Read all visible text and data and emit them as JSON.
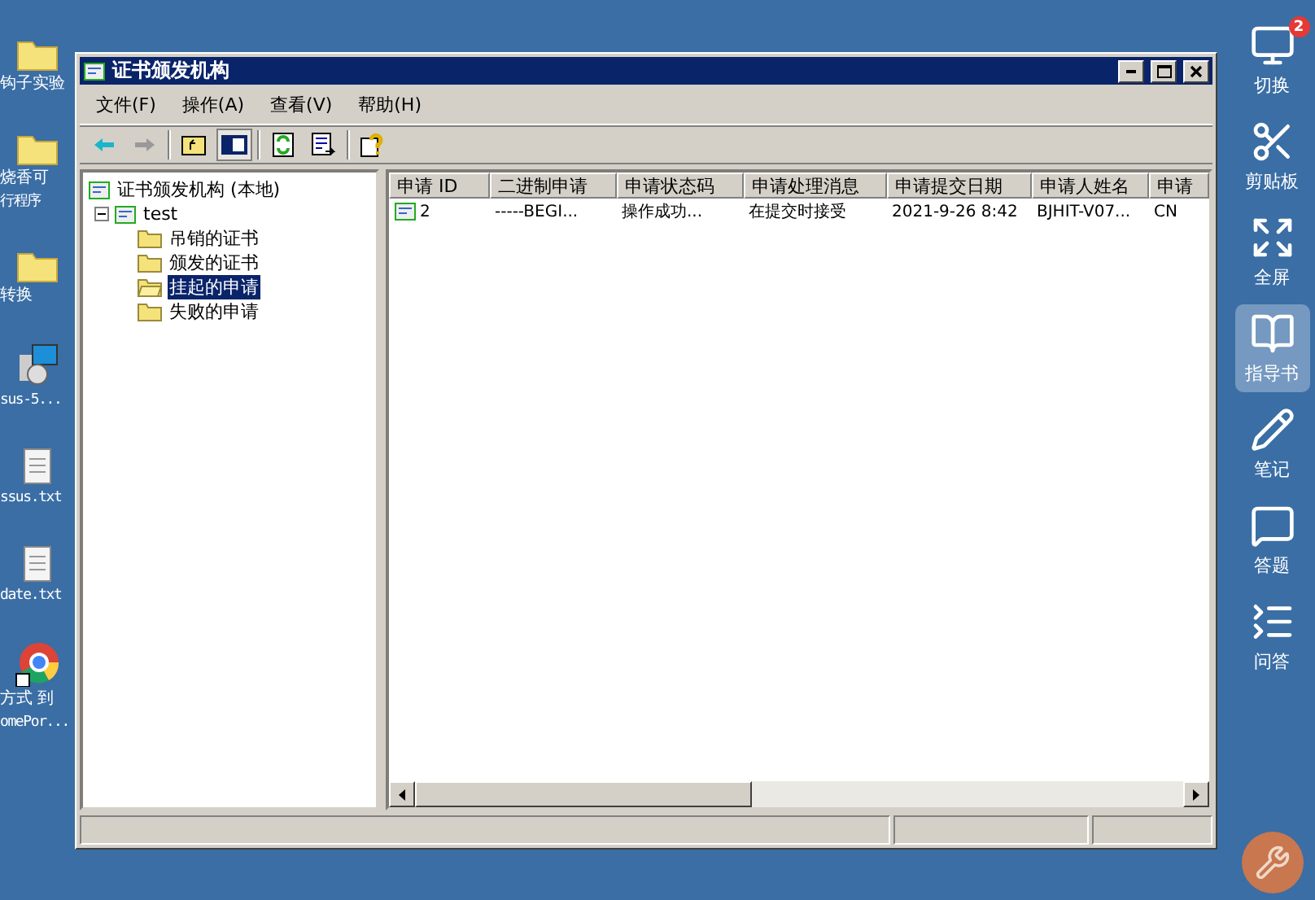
{
  "desktop_icons": [
    {
      "kind": "folder",
      "lines": [
        "钩子实验"
      ]
    },
    {
      "kind": "folder",
      "lines": [
        "烧香可",
        "行程序"
      ]
    },
    {
      "kind": "folder",
      "lines": [
        "转换"
      ]
    },
    {
      "kind": "installer",
      "lines": [
        "sus-5..."
      ]
    },
    {
      "kind": "notepad",
      "lines": [
        "ssus.txt"
      ]
    },
    {
      "kind": "notepad",
      "lines": [
        "date.txt"
      ]
    },
    {
      "kind": "browser",
      "lines": [
        "方式 到",
        "omePor..."
      ]
    }
  ],
  "window": {
    "title": "证书颁发机构",
    "menu": [
      "文件(F)",
      "操作(A)",
      "查看(V)",
      "帮助(H)"
    ],
    "toolbar": [
      {
        "kind": "back",
        "disabled": false
      },
      {
        "kind": "forward",
        "disabled": true
      },
      {
        "kind": "sep"
      },
      {
        "kind": "up",
        "selected": false
      },
      {
        "kind": "panes",
        "selected": true
      },
      {
        "kind": "sep"
      },
      {
        "kind": "refresh"
      },
      {
        "kind": "export"
      },
      {
        "kind": "sep"
      },
      {
        "kind": "help"
      }
    ],
    "tree": {
      "label": "证书颁发机构 (本地)",
      "children": [
        {
          "label": "test",
          "expanded": true,
          "children": [
            {
              "label": "吊销的证书",
              "selected": false
            },
            {
              "label": "颁发的证书",
              "selected": false
            },
            {
              "label": "挂起的申请",
              "selected": true
            },
            {
              "label": "失败的申请",
              "selected": false
            }
          ]
        }
      ]
    },
    "table": {
      "columns": [
        "申请 ID",
        "二进制申请",
        "申请状态码",
        "申请处理消息",
        "申请提交日期",
        "申请人姓名",
        "申请"
      ],
      "rows": [
        [
          "2",
          "-----BEGI...",
          "操作成功...",
          "在提交时接受",
          "2021-9-26 8:42",
          "BJHIT-V07...",
          "CN"
        ]
      ]
    }
  },
  "sidebar": {
    "items": [
      {
        "label": "切换",
        "badge": "2",
        "selected": false
      },
      {
        "label": "剪贴板",
        "selected": false
      },
      {
        "label": "全屏",
        "selected": false
      },
      {
        "label": "指导书",
        "selected": true
      },
      {
        "label": "笔记",
        "selected": false
      },
      {
        "label": "答题",
        "selected": false
      },
      {
        "label": "问答",
        "selected": false
      }
    ]
  }
}
